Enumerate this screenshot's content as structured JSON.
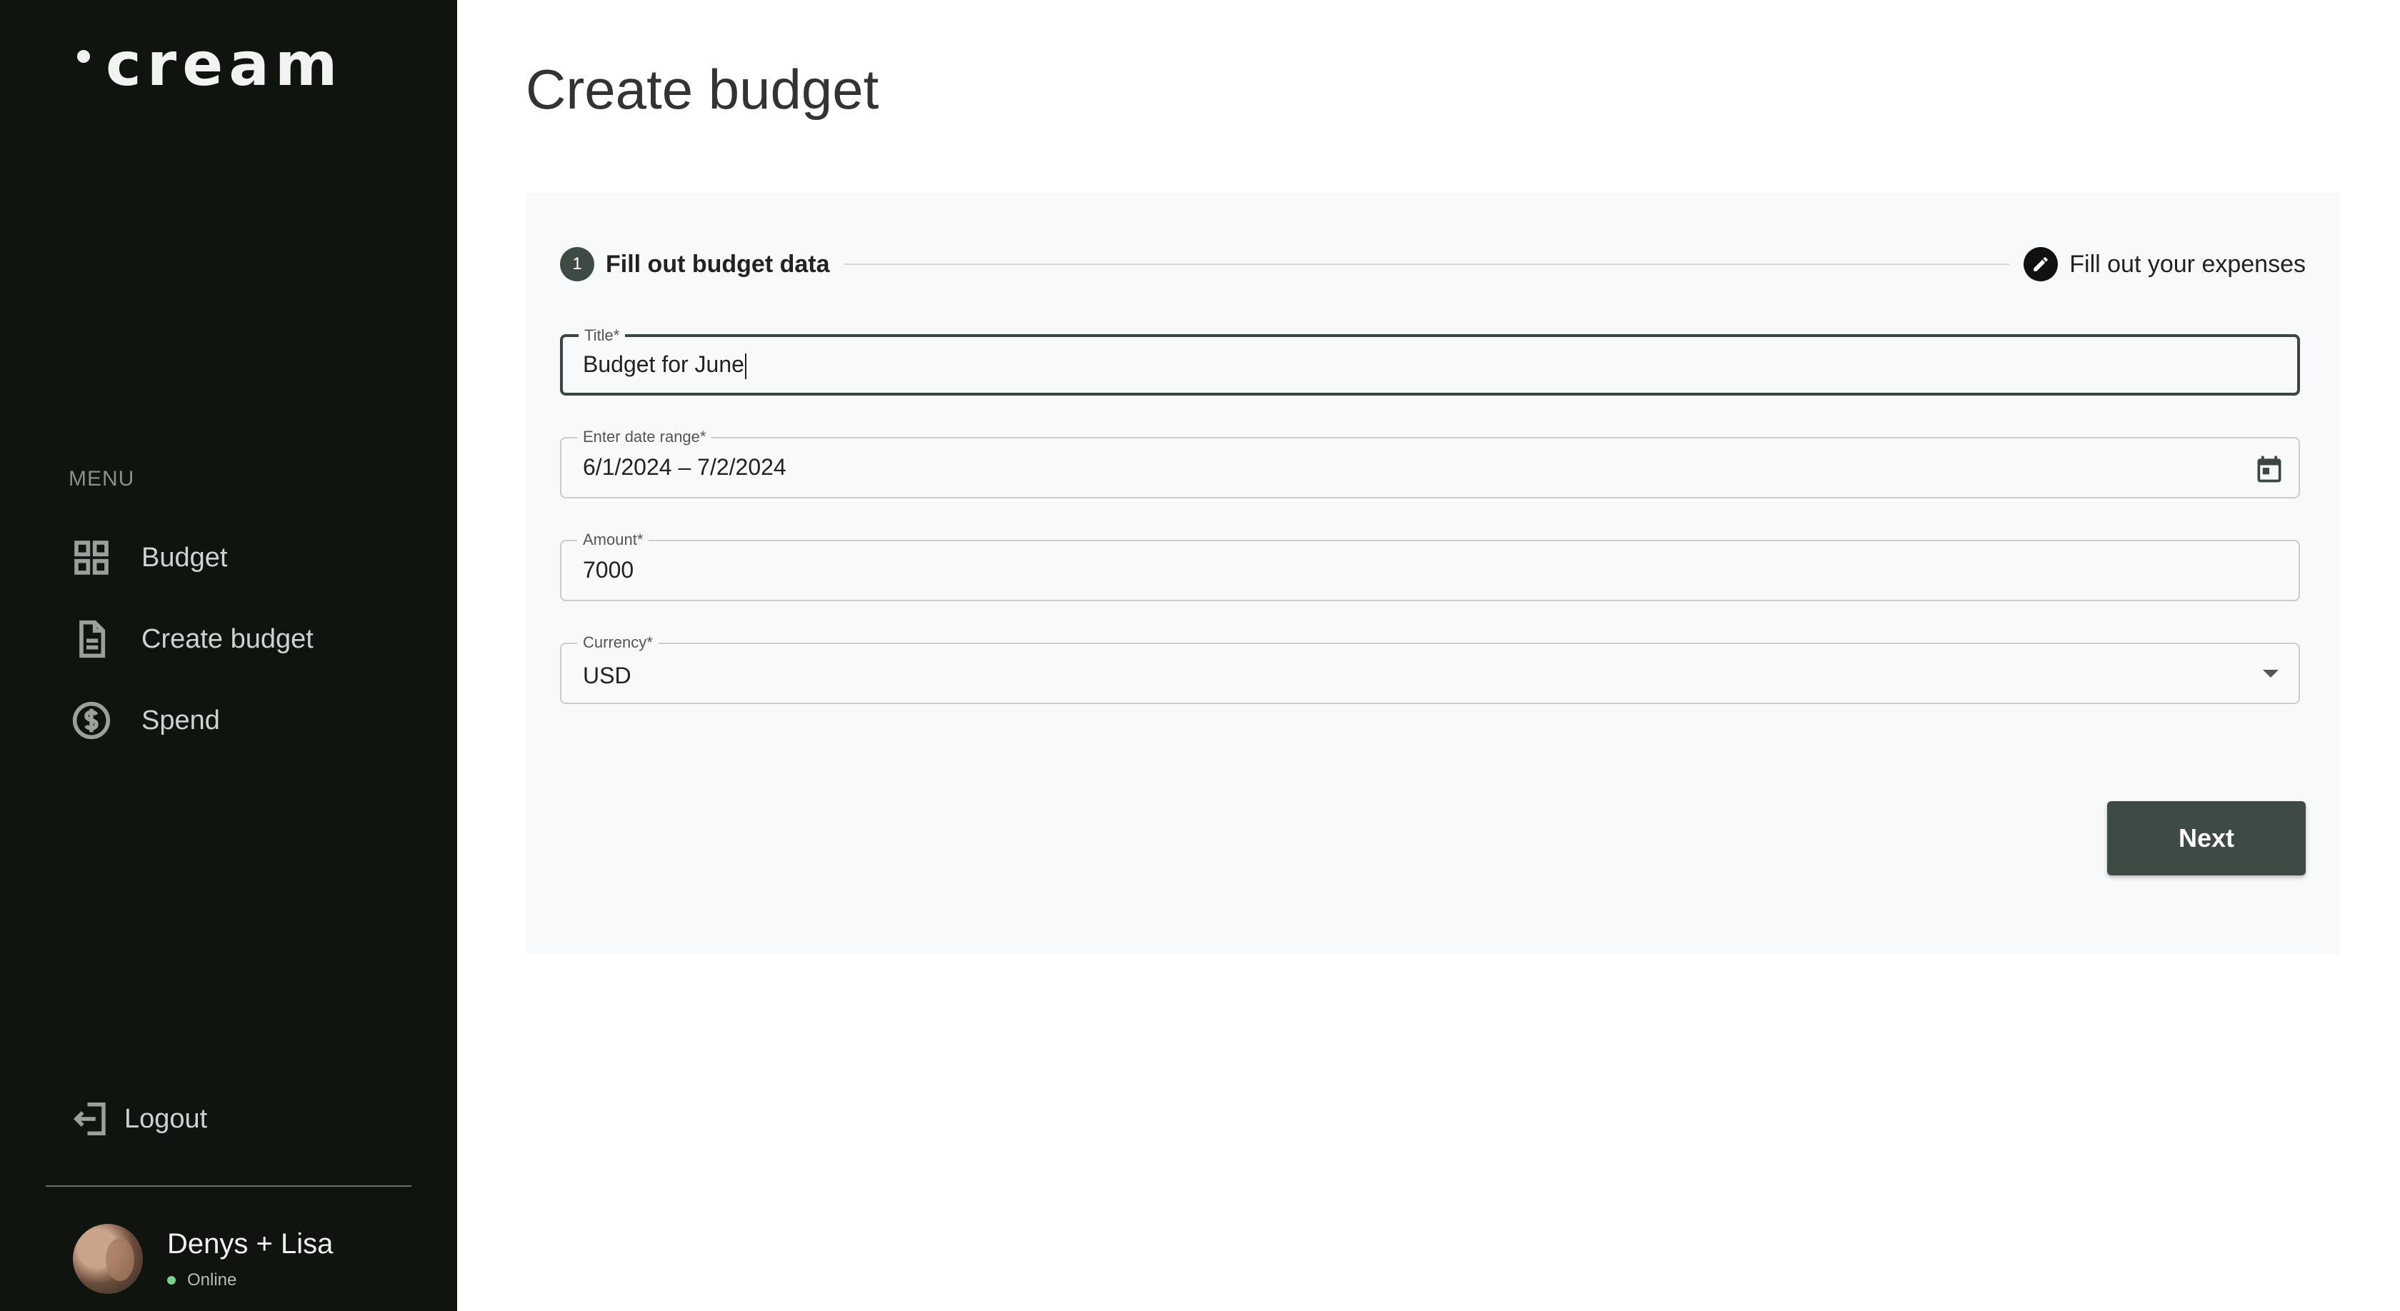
{
  "app": {
    "logo_text": "cream"
  },
  "sidebar": {
    "menu_label": "MENU",
    "items": [
      {
        "label": "Budget",
        "icon": "grid-icon"
      },
      {
        "label": "Create budget",
        "icon": "document-icon"
      },
      {
        "label": "Spend",
        "icon": "dollar-circle-icon"
      }
    ],
    "logout_label": "Logout",
    "user": {
      "name": "Denys + Lisa",
      "status": "Online"
    }
  },
  "main": {
    "title": "Create budget",
    "stepper": {
      "steps": [
        {
          "number": "1",
          "label": "Fill out budget data",
          "state": "active"
        },
        {
          "label": "Fill out your expenses",
          "state": "edit",
          "icon": "pencil-icon"
        }
      ]
    },
    "form": {
      "title": {
        "label": "Title*",
        "value": "Budget for June"
      },
      "date_range": {
        "label": "Enter date range*",
        "value": "6/1/2024 – 7/2/2024",
        "icon": "calendar-icon"
      },
      "amount": {
        "label": "Amount*",
        "value": "7000"
      },
      "currency": {
        "label": "Currency*",
        "value": "USD"
      }
    },
    "next_label": "Next"
  },
  "colors": {
    "sidebar_bg": "#0f140f",
    "accent": "#3e4a44",
    "card_bg": "#f8f9fa",
    "online": "#7bd389"
  }
}
